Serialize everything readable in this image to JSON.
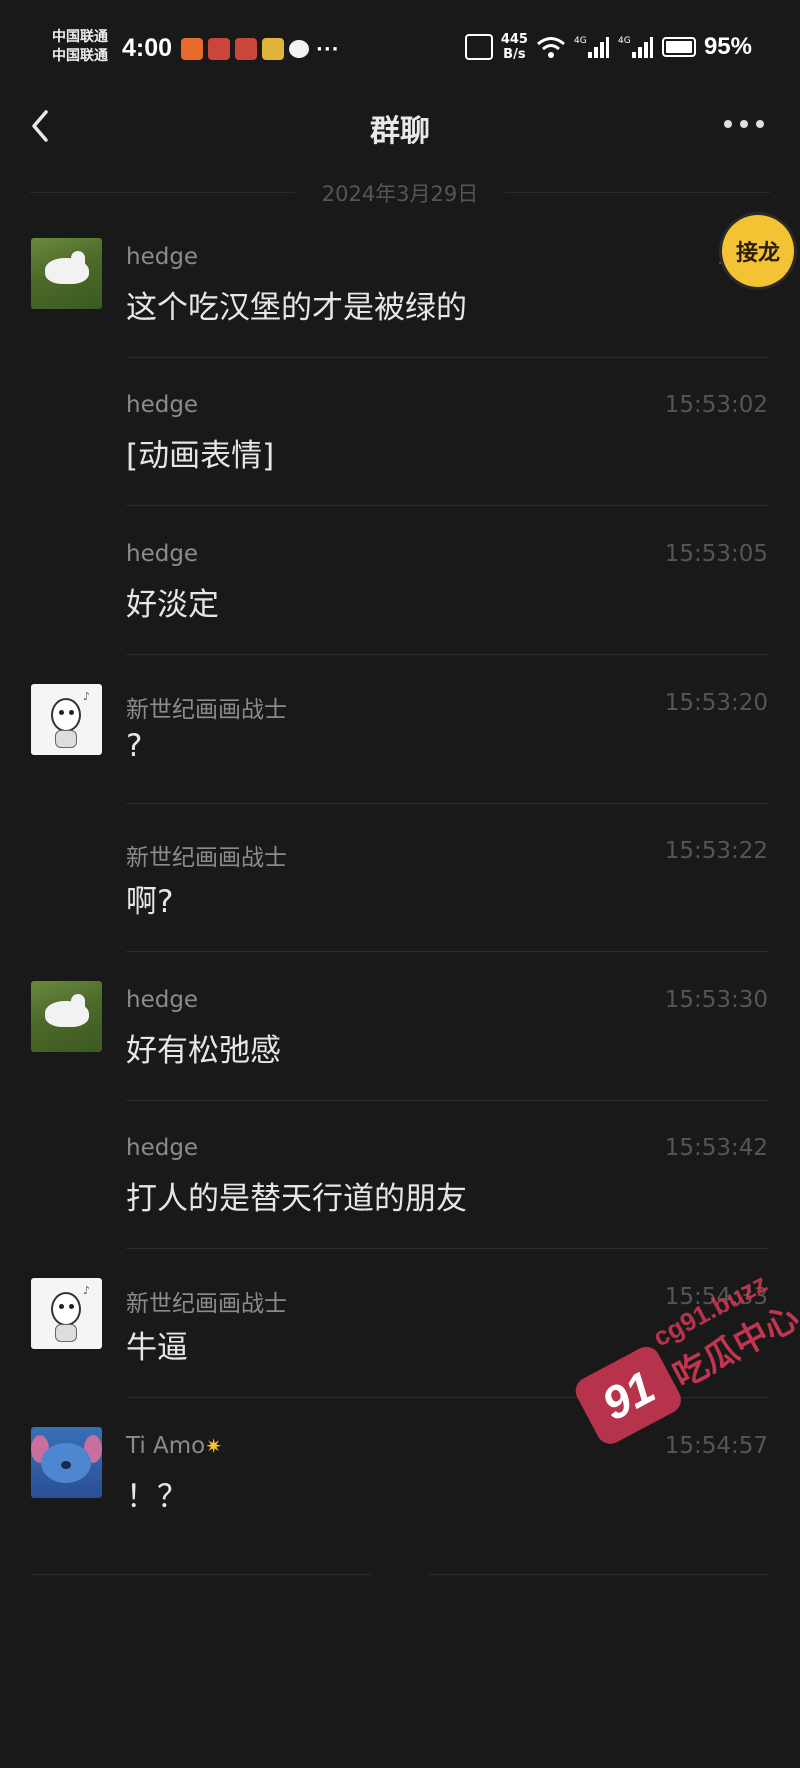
{
  "status_bar": {
    "carrier_1": "中国联通",
    "carrier_2": "中国联通",
    "time": "4:00",
    "net_speed_value": "445",
    "net_speed_unit": "B/s",
    "network_type_1": "4G",
    "network_type_2": "4G",
    "battery": "95%"
  },
  "nav": {
    "title": "群聊"
  },
  "date_divider": "2024年3月29日",
  "jielong_label": "接龙",
  "messages": [
    {
      "sender": "hedge",
      "time": "15:5",
      "text": "这个吃汉堡的才是被绿的",
      "avatar": "dog-on-grass"
    },
    {
      "sender": "hedge",
      "time": "15:53:02",
      "text": "[动画表情]"
    },
    {
      "sender": "hedge",
      "time": "15:53:05",
      "text": "好淡定"
    },
    {
      "sender": "新世纪画画战士",
      "time": "15:53:20",
      "text": "?",
      "avatar": "robot-headphones"
    },
    {
      "sender": "新世纪画画战士",
      "time": "15:53:22",
      "text": "啊?"
    },
    {
      "sender": "hedge",
      "time": "15:53:30",
      "text": "好有松弛感",
      "avatar": "dog-on-grass"
    },
    {
      "sender": "hedge",
      "time": "15:53:42",
      "text": "打人的是替天行道的朋友"
    },
    {
      "sender": "新世纪画画战士",
      "time": "15:54:33",
      "text": "牛逼",
      "avatar": "robot-headphones"
    },
    {
      "sender": "Ti Amo",
      "time": "15:54:57",
      "text": "！？",
      "avatar": "stitch"
    }
  ],
  "watermark": {
    "badge": "91",
    "url": "cg91.buzz",
    "name": "吃瓜中心"
  }
}
